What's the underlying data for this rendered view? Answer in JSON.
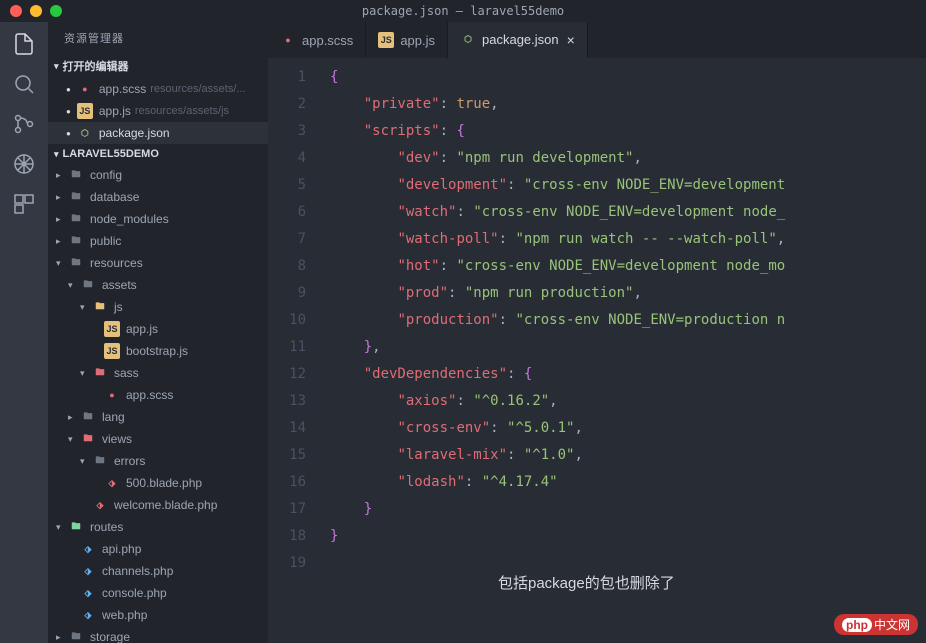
{
  "window": {
    "title": "package.json — laravel55demo"
  },
  "sidebar": {
    "title": "资源管理器",
    "open_editors_label": "打开的编辑器",
    "project_label": "LARAVEL55DEMO",
    "open_editors": [
      {
        "icon": "scss",
        "name": "app.scss",
        "path": "resources/assets/..."
      },
      {
        "icon": "js",
        "name": "app.js",
        "path": "resources/assets/js"
      },
      {
        "icon": "json",
        "name": "package.json",
        "path": "",
        "active": true
      }
    ],
    "tree": [
      {
        "lvl": 0,
        "chev": "right",
        "icon": "folder",
        "name": "config"
      },
      {
        "lvl": 0,
        "chev": "right",
        "icon": "folder",
        "name": "database"
      },
      {
        "lvl": 0,
        "chev": "right",
        "icon": "folder",
        "name": "node_modules"
      },
      {
        "lvl": 0,
        "chev": "right",
        "icon": "folder",
        "name": "public"
      },
      {
        "lvl": 0,
        "chev": "down",
        "icon": "folder-open",
        "name": "resources"
      },
      {
        "lvl": 1,
        "chev": "down",
        "icon": "folder-open",
        "name": "assets"
      },
      {
        "lvl": 2,
        "chev": "down",
        "icon": "folder-special",
        "name": "js"
      },
      {
        "lvl": 3,
        "chev": "none",
        "icon": "js",
        "name": "app.js"
      },
      {
        "lvl": 3,
        "chev": "none",
        "icon": "js",
        "name": "bootstrap.js"
      },
      {
        "lvl": 2,
        "chev": "down",
        "icon": "folder-scss",
        "name": "sass"
      },
      {
        "lvl": 3,
        "chev": "none",
        "icon": "scss",
        "name": "app.scss"
      },
      {
        "lvl": 1,
        "chev": "right",
        "icon": "folder",
        "name": "lang"
      },
      {
        "lvl": 1,
        "chev": "down",
        "icon": "folder-views",
        "name": "views"
      },
      {
        "lvl": 2,
        "chev": "down",
        "icon": "folder-open",
        "name": "errors"
      },
      {
        "lvl": 3,
        "chev": "none",
        "icon": "php",
        "name": "500.blade.php"
      },
      {
        "lvl": 2,
        "chev": "none",
        "icon": "php",
        "name": "welcome.blade.php"
      },
      {
        "lvl": 0,
        "chev": "down",
        "icon": "folder-routes",
        "name": "routes"
      },
      {
        "lvl": 1,
        "chev": "none",
        "icon": "php-blue",
        "name": "api.php"
      },
      {
        "lvl": 1,
        "chev": "none",
        "icon": "php-blue",
        "name": "channels.php"
      },
      {
        "lvl": 1,
        "chev": "none",
        "icon": "php-blue",
        "name": "console.php"
      },
      {
        "lvl": 1,
        "chev": "none",
        "icon": "php-blue",
        "name": "web.php"
      },
      {
        "lvl": 0,
        "chev": "right",
        "icon": "folder",
        "name": "storage"
      }
    ]
  },
  "tabs": [
    {
      "icon": "scss",
      "label": "app.scss"
    },
    {
      "icon": "js",
      "label": "app.js"
    },
    {
      "icon": "json",
      "label": "package.json",
      "active": true
    }
  ],
  "code": {
    "lines": [
      [
        {
          "t": "brace",
          "v": "{"
        }
      ],
      [
        {
          "t": "indent",
          "v": "    "
        },
        {
          "t": "key",
          "v": "\"private\""
        },
        {
          "t": "colon",
          "v": ": "
        },
        {
          "t": "bool",
          "v": "true"
        },
        {
          "t": "punct",
          "v": ","
        }
      ],
      [
        {
          "t": "indent",
          "v": "    "
        },
        {
          "t": "key",
          "v": "\"scripts\""
        },
        {
          "t": "colon",
          "v": ": "
        },
        {
          "t": "brace",
          "v": "{"
        }
      ],
      [
        {
          "t": "indent",
          "v": "        "
        },
        {
          "t": "key",
          "v": "\"dev\""
        },
        {
          "t": "colon",
          "v": ": "
        },
        {
          "t": "str",
          "v": "\"npm run development\""
        },
        {
          "t": "punct",
          "v": ","
        }
      ],
      [
        {
          "t": "indent",
          "v": "        "
        },
        {
          "t": "key",
          "v": "\"development\""
        },
        {
          "t": "colon",
          "v": ": "
        },
        {
          "t": "str",
          "v": "\"cross-env NODE_ENV=development"
        }
      ],
      [
        {
          "t": "indent",
          "v": "        "
        },
        {
          "t": "key",
          "v": "\"watch\""
        },
        {
          "t": "colon",
          "v": ": "
        },
        {
          "t": "str",
          "v": "\"cross-env NODE_ENV=development node_"
        }
      ],
      [
        {
          "t": "indent",
          "v": "        "
        },
        {
          "t": "key",
          "v": "\"watch-poll\""
        },
        {
          "t": "colon",
          "v": ": "
        },
        {
          "t": "str",
          "v": "\"npm run watch -- --watch-poll\""
        },
        {
          "t": "punct",
          "v": ","
        }
      ],
      [
        {
          "t": "indent",
          "v": "        "
        },
        {
          "t": "key",
          "v": "\"hot\""
        },
        {
          "t": "colon",
          "v": ": "
        },
        {
          "t": "str",
          "v": "\"cross-env NODE_ENV=development node_mo"
        }
      ],
      [
        {
          "t": "indent",
          "v": "        "
        },
        {
          "t": "key",
          "v": "\"prod\""
        },
        {
          "t": "colon",
          "v": ": "
        },
        {
          "t": "str",
          "v": "\"npm run production\""
        },
        {
          "t": "punct",
          "v": ","
        }
      ],
      [
        {
          "t": "indent",
          "v": "        "
        },
        {
          "t": "key",
          "v": "\"production\""
        },
        {
          "t": "colon",
          "v": ": "
        },
        {
          "t": "str",
          "v": "\"cross-env NODE_ENV=production n"
        }
      ],
      [
        {
          "t": "indent",
          "v": "    "
        },
        {
          "t": "brace",
          "v": "}"
        },
        {
          "t": "punct",
          "v": ","
        }
      ],
      [
        {
          "t": "indent",
          "v": "    "
        },
        {
          "t": "key",
          "v": "\"devDependencies\""
        },
        {
          "t": "colon",
          "v": ": "
        },
        {
          "t": "brace",
          "v": "{"
        }
      ],
      [
        {
          "t": "indent",
          "v": "        "
        },
        {
          "t": "key",
          "v": "\"axios\""
        },
        {
          "t": "colon",
          "v": ": "
        },
        {
          "t": "str",
          "v": "\"^0.16.2\""
        },
        {
          "t": "punct",
          "v": ","
        }
      ],
      [
        {
          "t": "indent",
          "v": "        "
        },
        {
          "t": "key",
          "v": "\"cross-env\""
        },
        {
          "t": "colon",
          "v": ": "
        },
        {
          "t": "str",
          "v": "\"^5.0.1\""
        },
        {
          "t": "punct",
          "v": ","
        }
      ],
      [
        {
          "t": "indent",
          "v": "        "
        },
        {
          "t": "key",
          "v": "\"laravel-mix\""
        },
        {
          "t": "colon",
          "v": ": "
        },
        {
          "t": "str",
          "v": "\"^1.0\""
        },
        {
          "t": "punct",
          "v": ","
        }
      ],
      [
        {
          "t": "indent",
          "v": "        "
        },
        {
          "t": "key",
          "v": "\"lodash\""
        },
        {
          "t": "colon",
          "v": ": "
        },
        {
          "t": "str",
          "v": "\"^4.17.4\""
        }
      ],
      [
        {
          "t": "indent",
          "v": "    "
        },
        {
          "t": "brace",
          "v": "}"
        }
      ],
      [
        {
          "t": "brace",
          "v": "}"
        }
      ],
      []
    ]
  },
  "annotation": "包括package的包也删除了",
  "watermark": {
    "left": "php",
    "right": "中文网"
  }
}
